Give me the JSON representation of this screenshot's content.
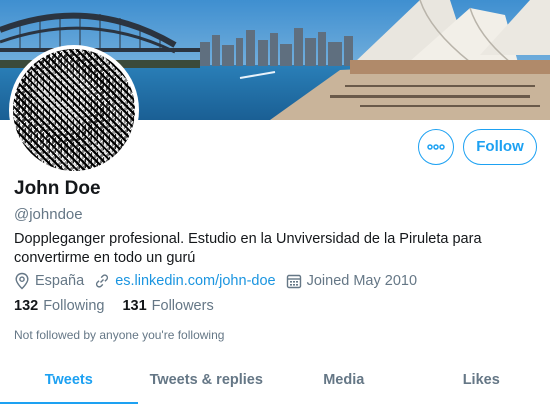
{
  "profile": {
    "name": "John Doe",
    "handle": "@johndoe",
    "bio": "Doppleganger profesional. Estudio en la Unviversidad de la Piruleta para convertirme en todo un gurú",
    "location": "España",
    "website": "es.linkedin.com/john-doe",
    "joined": "Joined May 2010"
  },
  "stats": {
    "following_count": "132",
    "following_label": "Following",
    "followers_count": "131",
    "followers_label": "Followers"
  },
  "notice": "Not followed by anyone you're following",
  "actions": {
    "follow_label": "Follow",
    "more_icon": "more-horizontal-icon"
  },
  "tabs": [
    {
      "label": "Tweets",
      "active": true
    },
    {
      "label": "Tweets & replies",
      "active": false
    },
    {
      "label": "Media",
      "active": false
    },
    {
      "label": "Likes",
      "active": false
    }
  ],
  "colors": {
    "accent": "#1da1f2",
    "link": "#1b95e0",
    "muted": "#657786",
    "text": "#14171a"
  },
  "icons": {
    "location": "location-pin-icon",
    "website": "link-icon",
    "joined": "calendar-icon"
  }
}
